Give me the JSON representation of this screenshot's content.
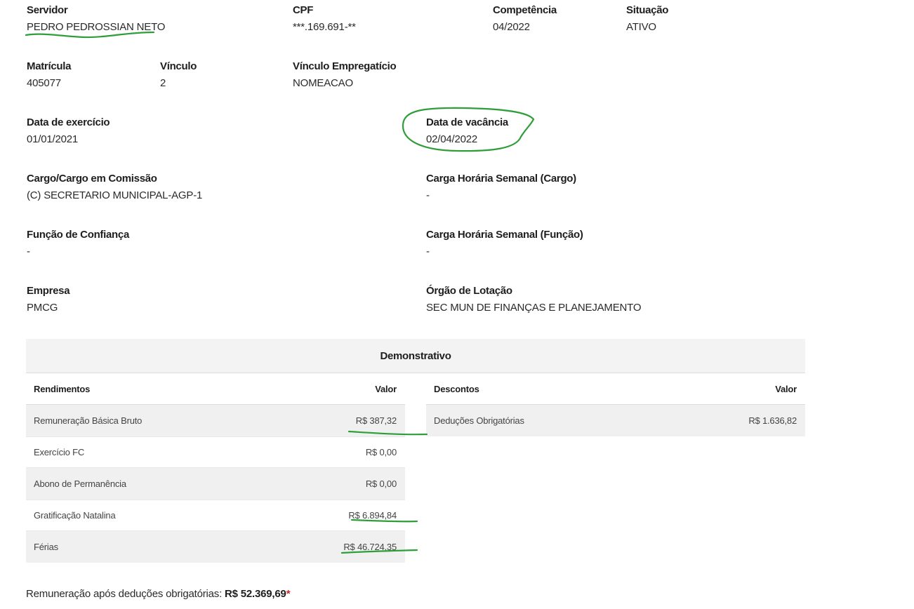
{
  "servidor": {
    "label": "Servidor",
    "value": "PEDRO PEDROSSIAN NETO"
  },
  "cpf": {
    "label": "CPF",
    "value": "***.169.691-**"
  },
  "competencia": {
    "label": "Competência",
    "value": "04/2022"
  },
  "situacao": {
    "label": "Situação",
    "value": "ATIVO"
  },
  "matricula": {
    "label": "Matrícula",
    "value": "405077"
  },
  "vinculo": {
    "label": "Vínculo",
    "value": "2"
  },
  "vinculo_empregaticio": {
    "label": "Vínculo Empregatício",
    "value": "NOMEACAO"
  },
  "data_exercicio": {
    "label": "Data de exercício",
    "value": "01/01/2021"
  },
  "data_vacancia": {
    "label": "Data de vacância",
    "value": "02/04/2022"
  },
  "cargo": {
    "label": "Cargo/Cargo em Comissão",
    "value": "(C) SECRETARIO MUNICIPAL-AGP-1"
  },
  "carga_cargo": {
    "label": "Carga Horária Semanal (Cargo)",
    "value": "-"
  },
  "funcao_confianca": {
    "label": "Função de Confiança",
    "value": "-"
  },
  "carga_funcao": {
    "label": "Carga Horária Semanal (Função)",
    "value": "-"
  },
  "empresa": {
    "label": "Empresa",
    "value": "PMCG"
  },
  "orgao_lotacao": {
    "label": "Órgão de Lotação",
    "value": "SEC MUN DE FINANÇAS E PLANEJAMENTO"
  },
  "demonstrativo": {
    "title": "Demonstrativo",
    "rendimentos": {
      "header": "Rendimentos",
      "value_header": "Valor",
      "rows": [
        {
          "label": "Remuneração Básica Bruto",
          "value": "R$ 387,32"
        },
        {
          "label": "Exercício FC",
          "value": "R$ 0,00"
        },
        {
          "label": "Abono de Permanência",
          "value": "R$ 0,00"
        },
        {
          "label": "Gratificação Natalina",
          "value": "R$ 6.894,84"
        },
        {
          "label": "Férias",
          "value": "R$ 46.724,35"
        }
      ]
    },
    "descontos": {
      "header": "Descontos",
      "value_header": "Valor",
      "rows": [
        {
          "label": "Deduções Obrigatórias",
          "value": "R$ 1.636,82"
        }
      ]
    }
  },
  "footer": {
    "label": "Remuneração após deduções obrigatórias:",
    "total": "R$ 52.369,69",
    "asterisk": "*"
  },
  "colors": {
    "annotation": "#2e9e3a",
    "asterisk": "#c62828"
  }
}
